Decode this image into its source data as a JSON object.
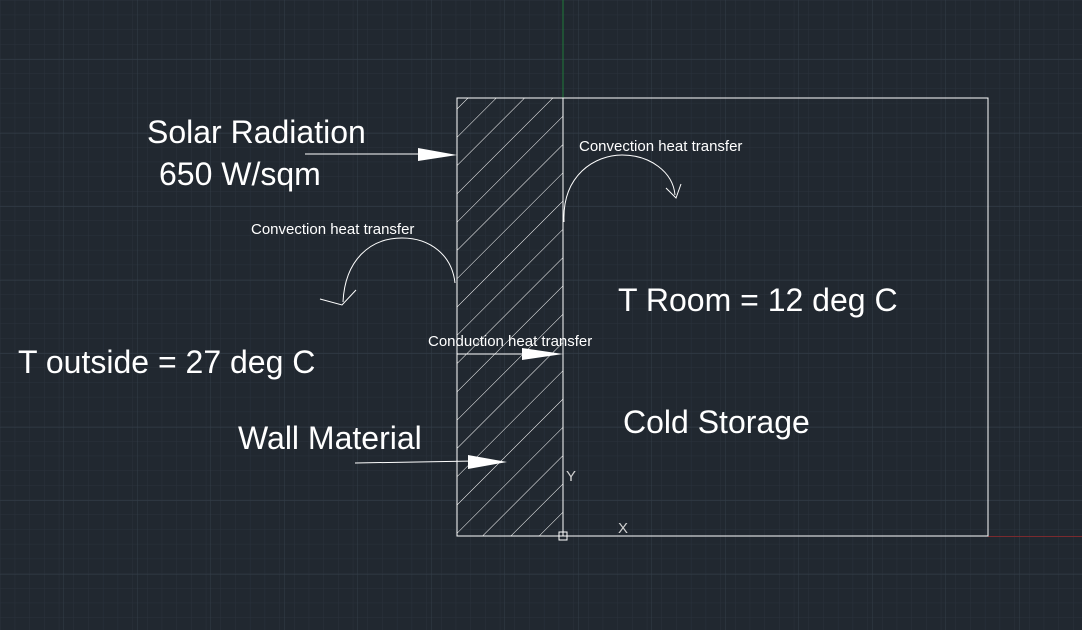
{
  "labels": {
    "solar_radiation": "Solar Radiation",
    "solar_value": "650 W/sqm",
    "convection_inside": "Convection heat transfer",
    "convection_outside": "Convection heat transfer",
    "conduction": "Conduction heat transfer",
    "t_outside": "T outside = 27 deg C",
    "t_room": "T Room = 12 deg C",
    "cold_storage": "Cold Storage",
    "wall_material": "Wall Material",
    "ucs_y": "Y",
    "ucs_x": "X"
  },
  "colors": {
    "background": "#212830",
    "grid_minor": "#2a323c",
    "grid_major": "#333d48",
    "lines": "#ffffff",
    "axis_y": "#1f7a3a",
    "axis_x": "#7a2a2e"
  },
  "icons": {
    "ucs": "ucs-icon"
  }
}
